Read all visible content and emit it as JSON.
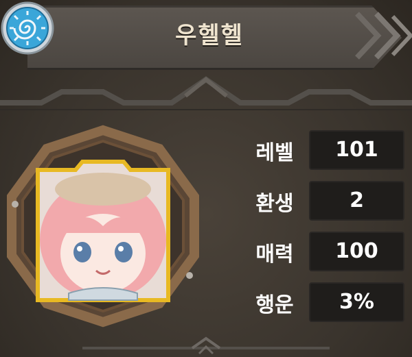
{
  "header": {
    "title": "우헬헬",
    "emblem_icon": "spiral-emblem-icon"
  },
  "character": {
    "portrait_icon": "pink-haired-character-portrait"
  },
  "stats": [
    {
      "label": "레벨",
      "value": "101"
    },
    {
      "label": "환생",
      "value": "2"
    },
    {
      "label": "매력",
      "value": "100"
    },
    {
      "label": "행운",
      "value": "3%"
    }
  ],
  "colors": {
    "panel": "#3a342d",
    "header": "#55504a",
    "value_box": "#1f1d1b",
    "frame_wood": "#8a6a4a",
    "frame_gold": "#e8b923",
    "emblem_blue": "#3aa6d9"
  }
}
